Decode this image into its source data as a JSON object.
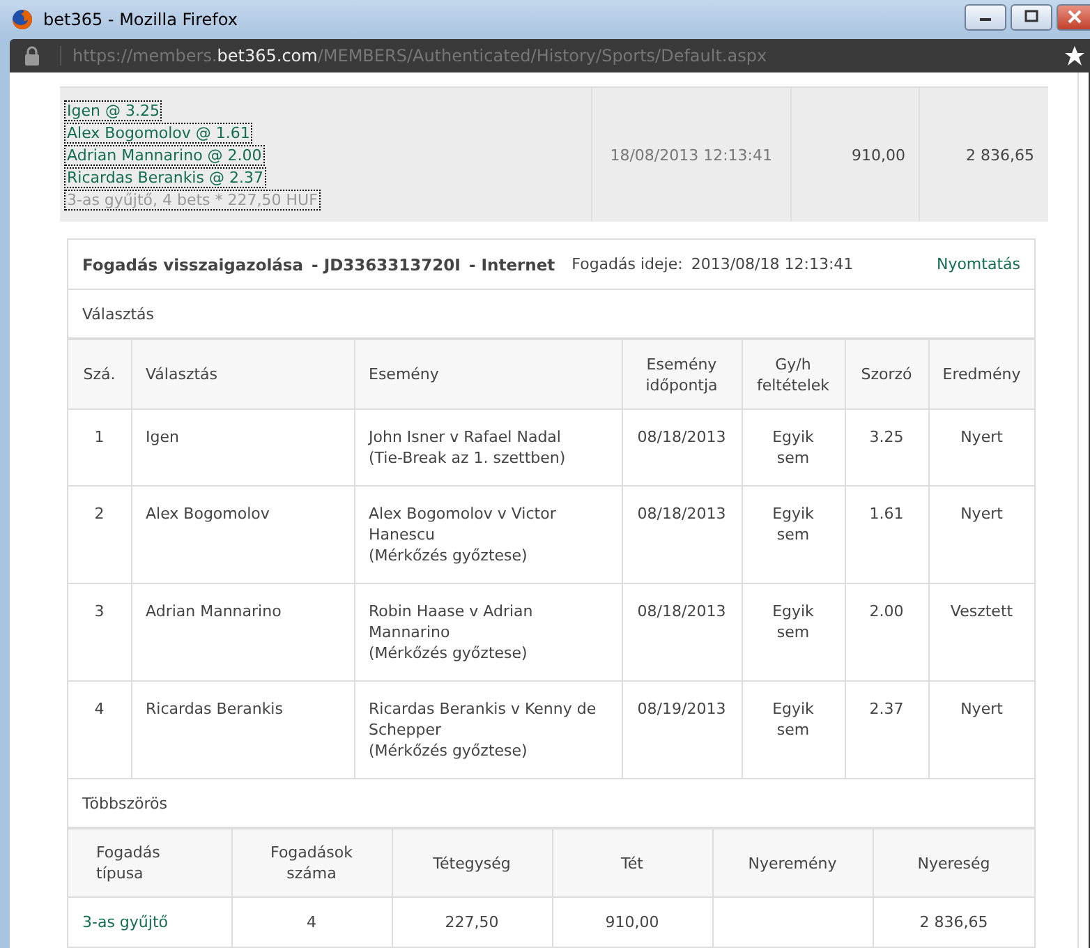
{
  "window": {
    "title": "bet365 - Mozilla Firefox"
  },
  "address": {
    "prefix": "https://members.",
    "domain": "bet365.com",
    "path": "/MEMBERS/Authenticated/History/Sports/Default.aspx"
  },
  "summary": {
    "selections": [
      "Igen @ 3.25",
      "Alex Bogomolov @ 1.61",
      "Adrian Mannarino @ 2.00",
      "Ricardas Berankis @ 2.37"
    ],
    "bet_line": "3-as gyűjtő, 4  bets * 227,50 HUF",
    "date": "18/08/2013 12:13:41",
    "stake": "910,00",
    "returns": "2 836,65"
  },
  "confirmation": {
    "title": "Fogadás visszaigazolása",
    "ref": "- JD3363313720I",
    "channel": "- Internet",
    "time_label": "Fogadás ideje:",
    "time": "2013/08/18 12:13:41",
    "print_link": "Nyomtatás"
  },
  "selections_section": {
    "heading": "Választás",
    "columns": [
      "Szá.",
      "Választás",
      "Esemény",
      "Esemény időpontja",
      "Gy/h feltételek",
      "Szorzó",
      "Eredmény"
    ],
    "rows": [
      {
        "no": "1",
        "selection": "Igen",
        "event": [
          "John Isner v Rafael Nadal",
          "(Tie-Break az 1. szettben)"
        ],
        "date": "08/18/2013",
        "terms": "Egyik sem",
        "odds": "3.25",
        "result": "Nyert"
      },
      {
        "no": "2",
        "selection": "Alex Bogomolov",
        "event": [
          "Alex Bogomolov v Victor Hanescu",
          "(Mérkőzés győztese)"
        ],
        "date": "08/18/2013",
        "terms": "Egyik sem",
        "odds": "1.61",
        "result": "Nyert"
      },
      {
        "no": "3",
        "selection": "Adrian Mannarino",
        "event": [
          "Robin Haase v Adrian Mannarino",
          "(Mérkőzés győztese)"
        ],
        "date": "08/18/2013",
        "terms": "Egyik sem",
        "odds": "2.00",
        "result": "Vesztett"
      },
      {
        "no": "4",
        "selection": "Ricardas Berankis",
        "event": [
          "Ricardas Berankis v Kenny de Schepper",
          "(Mérkőzés győztese)"
        ],
        "date": "08/19/2013",
        "terms": "Egyik sem",
        "odds": "2.37",
        "result": "Nyert"
      }
    ]
  },
  "multiples_section": {
    "heading": "Többszörös",
    "columns": [
      "Fogadás típusa",
      "Fogadások száma",
      "Tétegység",
      "Tét",
      "Nyeremény",
      "Nyereség"
    ],
    "rows": [
      {
        "type": "3-as gyűjtő",
        "count": "4",
        "unit": "227,50",
        "stake": "910,00",
        "winnings": "",
        "profit": "2 836,65"
      }
    ]
  }
}
